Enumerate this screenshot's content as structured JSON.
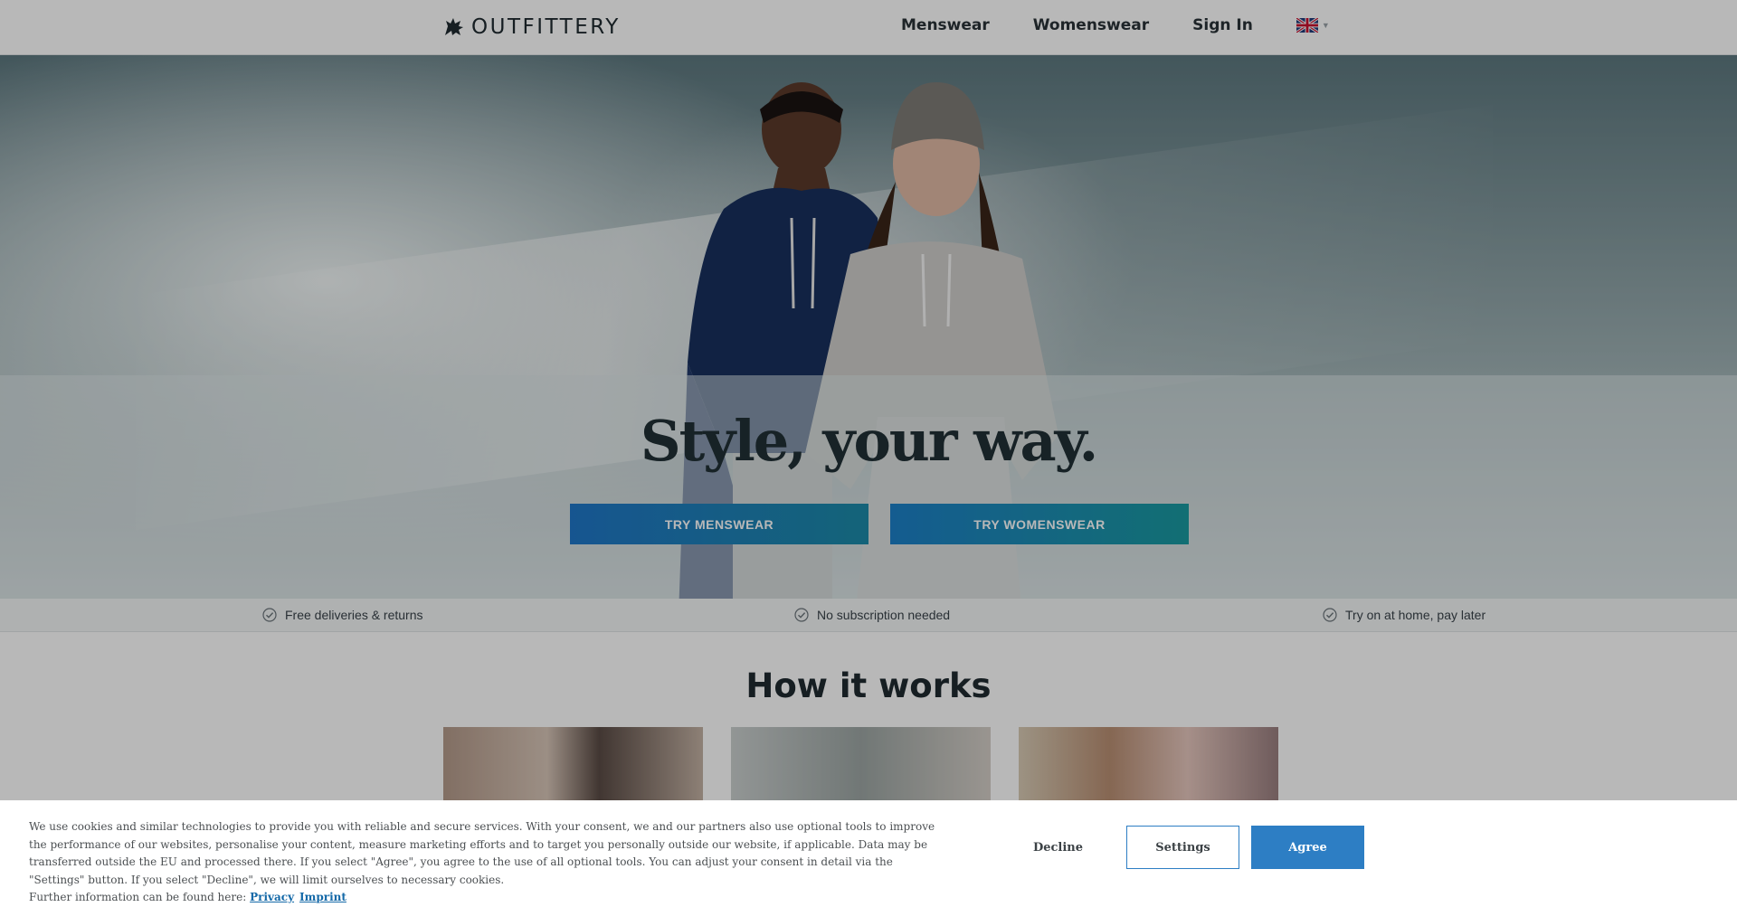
{
  "header": {
    "brand": "OUTFITTERY",
    "nav": [
      "Menswear",
      "Womenswear",
      "Sign In"
    ],
    "language_flag_icon": "uk-flag-icon"
  },
  "hero": {
    "headline": "Style, your way.",
    "cta_men": "TRY MENSWEAR",
    "cta_women": "TRY WOMENSWEAR"
  },
  "benefits": [
    "Free deliveries & returns",
    "No subscription needed",
    "Try on at home, pay later"
  ],
  "how": {
    "title": "How it works"
  },
  "cookie": {
    "text": "We use cookies and similar technologies to provide you with reliable and secure services. With your consent, we and our partners also use optional tools to improve the performance of our websites, personalise your content, measure marketing efforts and to target you personally outside our website, if applicable. Data may be transferred outside the EU and processed there. If you select \"Agree\", you agree to the use of all optional tools. You can adjust your consent in detail via the \"Settings\" button. If you select \"Decline\", we will limit ourselves to necessary cookies.",
    "more_info": "Further information can be found here:",
    "privacy_link": "Privacy",
    "imprint_link": "Imprint",
    "decline_label": "Decline",
    "settings_label": "Settings",
    "agree_label": "Agree"
  },
  "colors": {
    "accent": "#2d7ec4",
    "cta_gradient_end": "#1a9aa0"
  }
}
